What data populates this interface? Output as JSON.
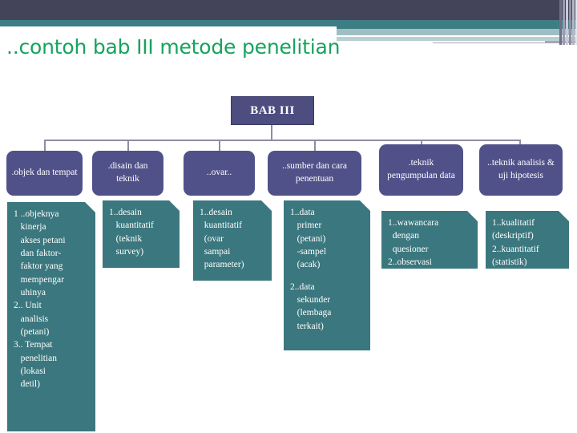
{
  "slide": {
    "title": "..contoh bab III metode penelitian",
    "title_color": "#17a35e",
    "background": "#ffffff"
  },
  "theme": {
    "header_dark": "#434359",
    "header_teal": "#3d7d84",
    "header_pale": "#9fbec2",
    "node_purple": "#51518a",
    "root_purple": "#4d4d7f",
    "leaf_teal": "#3b777e",
    "connector": "#8d8da6"
  },
  "diagram": {
    "root": {
      "label": "BAB III"
    },
    "categories": [
      {
        "label": ".objek dan tempat"
      },
      {
        "label": ".disain dan teknik"
      },
      {
        "label": "..ovar.."
      },
      {
        "label": "..sumber dan cara  penentuan"
      },
      {
        "label": ".teknik pengumpulan data"
      },
      {
        "label": "..teknik analisis  & uji hipotesis"
      }
    ],
    "details": [
      {
        "lines": [
          "1 ..objeknya",
          "   kinerja",
          "   akses petani",
          "   dan faktor-",
          "   faktor yang",
          "   mempengar",
          "   uhinya",
          "2.. Unit",
          "   analisis",
          "   (petani)",
          "3.. Tempat",
          "   penelitian",
          "   (lokasi",
          "   detil)"
        ]
      },
      {
        "lines": [
          "1..desain",
          "   kuantitatif",
          "   (teknik",
          "   survey)"
        ]
      },
      {
        "lines": [
          "1..desain",
          "  kuantitatif",
          "  (ovar",
          "  sampai",
          "  parameter)"
        ]
      },
      {
        "lines": [
          "1..data",
          "   primer",
          "   (petani)",
          "   -sampel",
          "   (acak)",
          "",
          "2..data",
          "   sekunder",
          "   (lembaga",
          "   terkait)"
        ]
      },
      {
        "lines": [
          "1..wawancara",
          "  dengan",
          "  quesioner",
          "2..observasi"
        ]
      },
      {
        "lines": [
          "1..kualitatif",
          "(deskriptif)",
          "2..kuantitatif",
          "(statistik)"
        ]
      }
    ]
  }
}
